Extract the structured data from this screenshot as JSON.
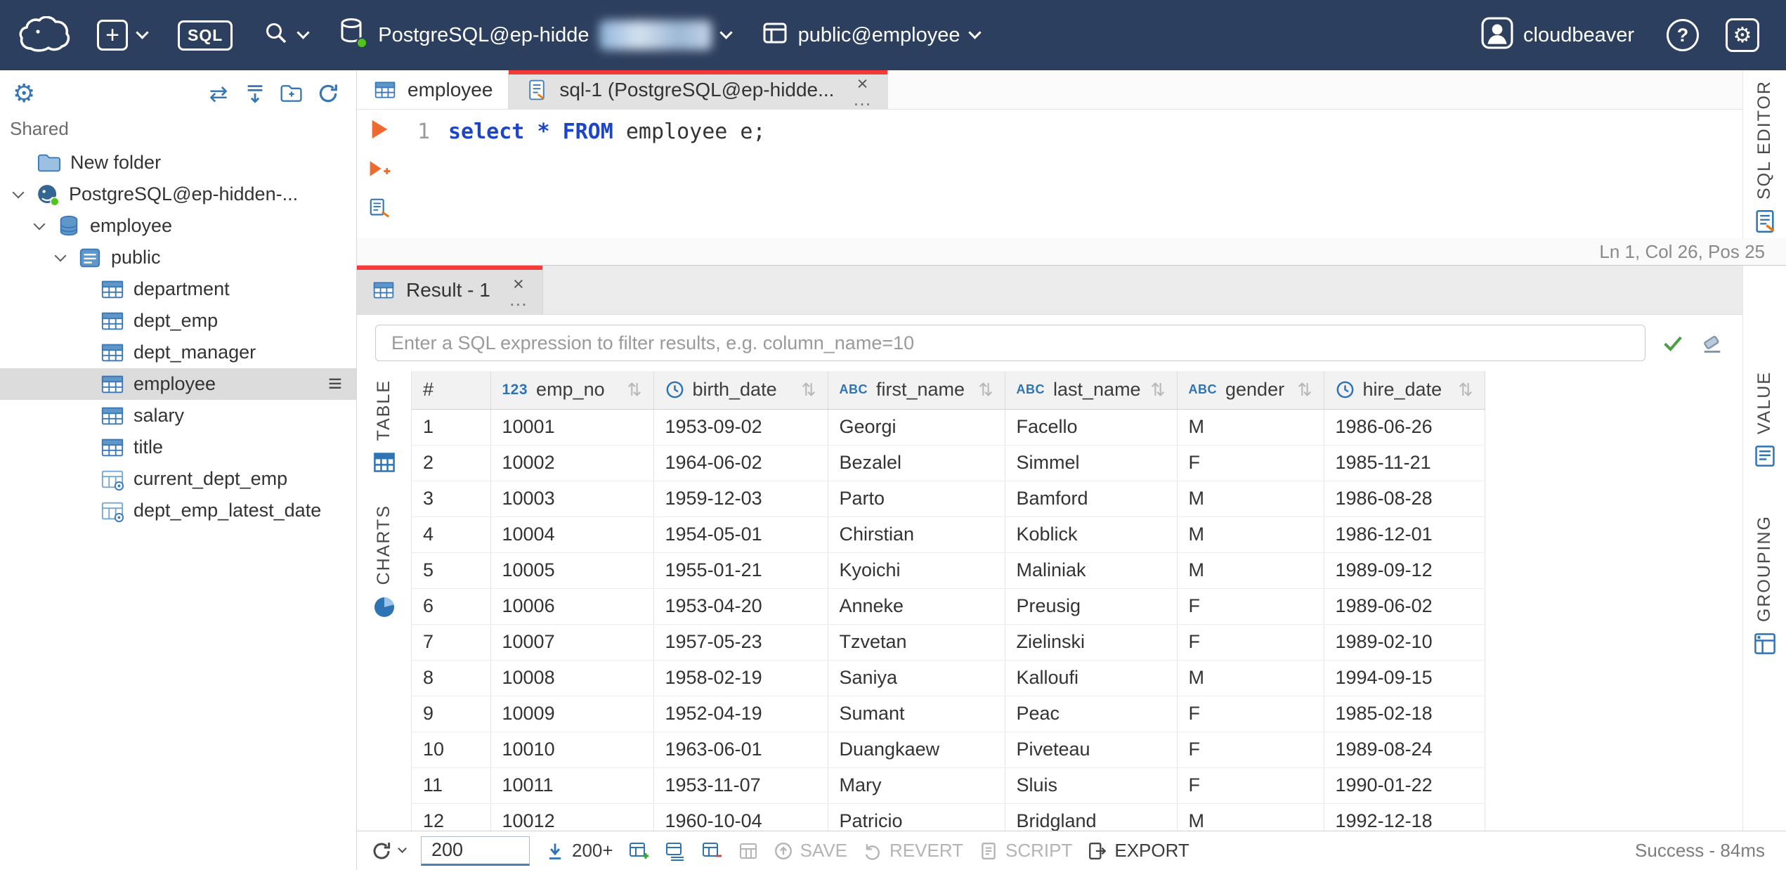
{
  "icons": {
    "plus": "+",
    "help": "?",
    "gear": "⚙",
    "close": "×",
    "menu_dots": "…",
    "sort": "⇅",
    "drag_handle": "≡",
    "sync": "⇄"
  },
  "colors": {
    "topbar": "#2d3f5e",
    "accent_blue": "#2e74b5",
    "tab_indicator": "#f43b3a",
    "run_orange": "#ee6b2f",
    "success_green": "#4b9e47",
    "status_dot_green": "#52c41a"
  },
  "topbar": {
    "sql_badge": "SQL",
    "connection_label": "PostgreSQL@ep-hidde",
    "schema_label": "public@employee",
    "user_label": "cloudbeaver"
  },
  "sidebar": {
    "section_label": "Shared",
    "tree": [
      {
        "label": "New folder",
        "icon": "folder",
        "indent": 1,
        "expanded": false,
        "selected": false
      },
      {
        "label": "PostgreSQL@ep-hidden-...",
        "icon": "postgres",
        "indent": 1,
        "expanded": true,
        "selected": false
      },
      {
        "label": "employee",
        "icon": "database",
        "indent": 2,
        "expanded": true,
        "selected": false
      },
      {
        "label": "public",
        "icon": "schema",
        "indent": 3,
        "expanded": true,
        "selected": false
      },
      {
        "label": "department",
        "icon": "table",
        "indent": 4,
        "expanded": false,
        "selected": false
      },
      {
        "label": "dept_emp",
        "icon": "table",
        "indent": 4,
        "expanded": false,
        "selected": false
      },
      {
        "label": "dept_manager",
        "icon": "table",
        "indent": 4,
        "expanded": false,
        "selected": false
      },
      {
        "label": "employee",
        "icon": "table",
        "indent": 4,
        "expanded": false,
        "selected": true
      },
      {
        "label": "salary",
        "icon": "table",
        "indent": 4,
        "expanded": false,
        "selected": false
      },
      {
        "label": "title",
        "icon": "table",
        "indent": 4,
        "expanded": false,
        "selected": false
      },
      {
        "label": "current_dept_emp",
        "icon": "view",
        "indent": 4,
        "expanded": false,
        "selected": false
      },
      {
        "label": "dept_emp_latest_date",
        "icon": "view",
        "indent": 4,
        "expanded": false,
        "selected": false
      }
    ]
  },
  "editor": {
    "tabs": {
      "table_tab": "employee",
      "sql_tab": "sql-1 (PostgreSQL@ep-hidde..."
    },
    "line_number": "1",
    "code": {
      "keyword1": "select",
      "star": "*",
      "keyword2": "FROM",
      "rest": "employee e;"
    },
    "status": "Ln 1, Col 26, Pos 25",
    "rail_label": "SQL EDITOR"
  },
  "result": {
    "tab_label": "Result - 1",
    "filter_placeholder": "Enter a SQL expression to filter results, e.g. column_name=10",
    "left_tabs": {
      "table": "TABLE",
      "charts": "CHARTS"
    },
    "right_tabs": {
      "value": "VALUE",
      "grouping": "GROUPING"
    },
    "grid": {
      "type_glyphs": {
        "number": "123",
        "string": "ABC"
      },
      "columns": [
        {
          "label": "#",
          "type": "index"
        },
        {
          "label": "emp_no",
          "type": "number"
        },
        {
          "label": "birth_date",
          "type": "date"
        },
        {
          "label": "first_name",
          "type": "string"
        },
        {
          "label": "last_name",
          "type": "string"
        },
        {
          "label": "gender",
          "type": "string"
        },
        {
          "label": "hire_date",
          "type": "date"
        }
      ],
      "rows": [
        [
          "1",
          "10001",
          "1953-09-02",
          "Georgi",
          "Facello",
          "M",
          "1986-06-26"
        ],
        [
          "2",
          "10002",
          "1964-06-02",
          "Bezalel",
          "Simmel",
          "F",
          "1985-11-21"
        ],
        [
          "3",
          "10003",
          "1959-12-03",
          "Parto",
          "Bamford",
          "M",
          "1986-08-28"
        ],
        [
          "4",
          "10004",
          "1954-05-01",
          "Chirstian",
          "Koblick",
          "M",
          "1986-12-01"
        ],
        [
          "5",
          "10005",
          "1955-01-21",
          "Kyoichi",
          "Maliniak",
          "M",
          "1989-09-12"
        ],
        [
          "6",
          "10006",
          "1953-04-20",
          "Anneke",
          "Preusig",
          "F",
          "1989-06-02"
        ],
        [
          "7",
          "10007",
          "1957-05-23",
          "Tzvetan",
          "Zielinski",
          "F",
          "1989-02-10"
        ],
        [
          "8",
          "10008",
          "1958-02-19",
          "Saniya",
          "Kalloufi",
          "M",
          "1994-09-15"
        ],
        [
          "9",
          "10009",
          "1952-04-19",
          "Sumant",
          "Peac",
          "F",
          "1985-02-18"
        ],
        [
          "10",
          "10010",
          "1963-06-01",
          "Duangkaew",
          "Piveteau",
          "F",
          "1989-08-24"
        ],
        [
          "11",
          "10011",
          "1953-11-07",
          "Mary",
          "Sluis",
          "F",
          "1990-01-22"
        ],
        [
          "12",
          "10012",
          "1960-10-04",
          "Patricio",
          "Bridgland",
          "M",
          "1992-12-18"
        ]
      ]
    },
    "toolbar": {
      "fetch_size": "200",
      "fetch_more_label": "200+",
      "save_label": "SAVE",
      "revert_label": "REVERT",
      "script_label": "SCRIPT",
      "export_label": "EXPORT",
      "status": "Success - 84ms"
    }
  }
}
